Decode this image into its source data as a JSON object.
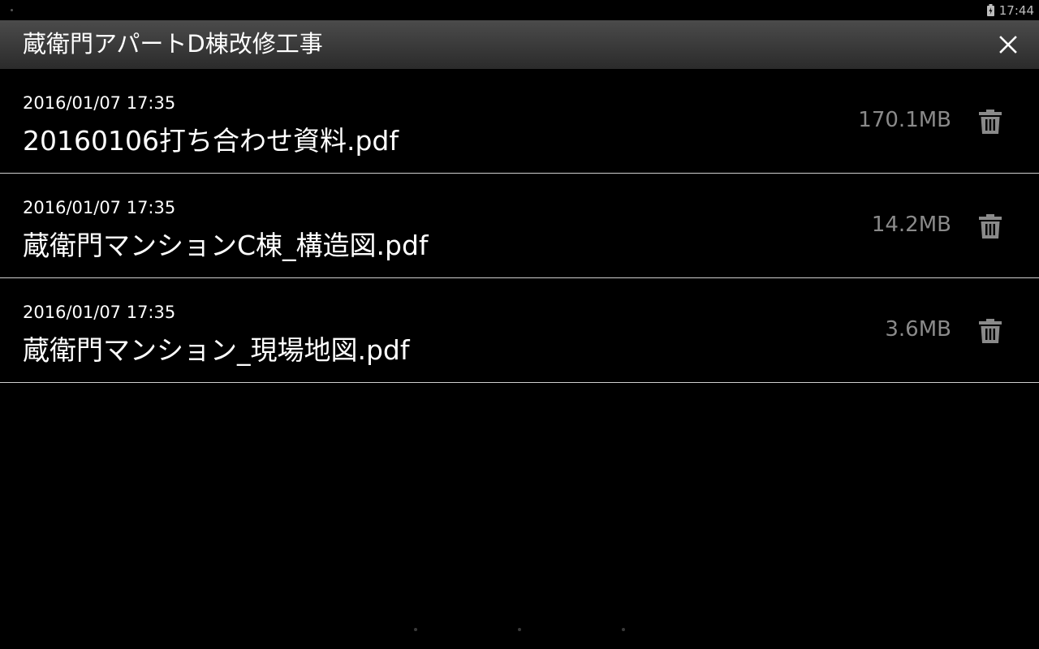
{
  "status_bar": {
    "time": "17:44"
  },
  "header": {
    "title": "蔵衛門アパートD棟改修工事"
  },
  "files": [
    {
      "date": "2016/01/07 17:35",
      "name": "20160106打ち合わせ資料.pdf",
      "size": "170.1MB"
    },
    {
      "date": "2016/01/07 17:35",
      "name": "蔵衛門マンションC棟_構造図.pdf",
      "size": "14.2MB"
    },
    {
      "date": "2016/01/07 17:35",
      "name": "蔵衛門マンション_現場地図.pdf",
      "size": "3.6MB"
    }
  ],
  "icons": {
    "close": "close-icon",
    "delete": "trash-icon",
    "battery": "battery-charging-icon"
  },
  "colors": {
    "background": "#000000",
    "title_bar_top": "#4b4b4b",
    "title_bar_bottom": "#2b2b2b",
    "size_text": "#8a8a8a",
    "trash_icon": "#8a8a8a",
    "divider": "#cfcfcf"
  }
}
